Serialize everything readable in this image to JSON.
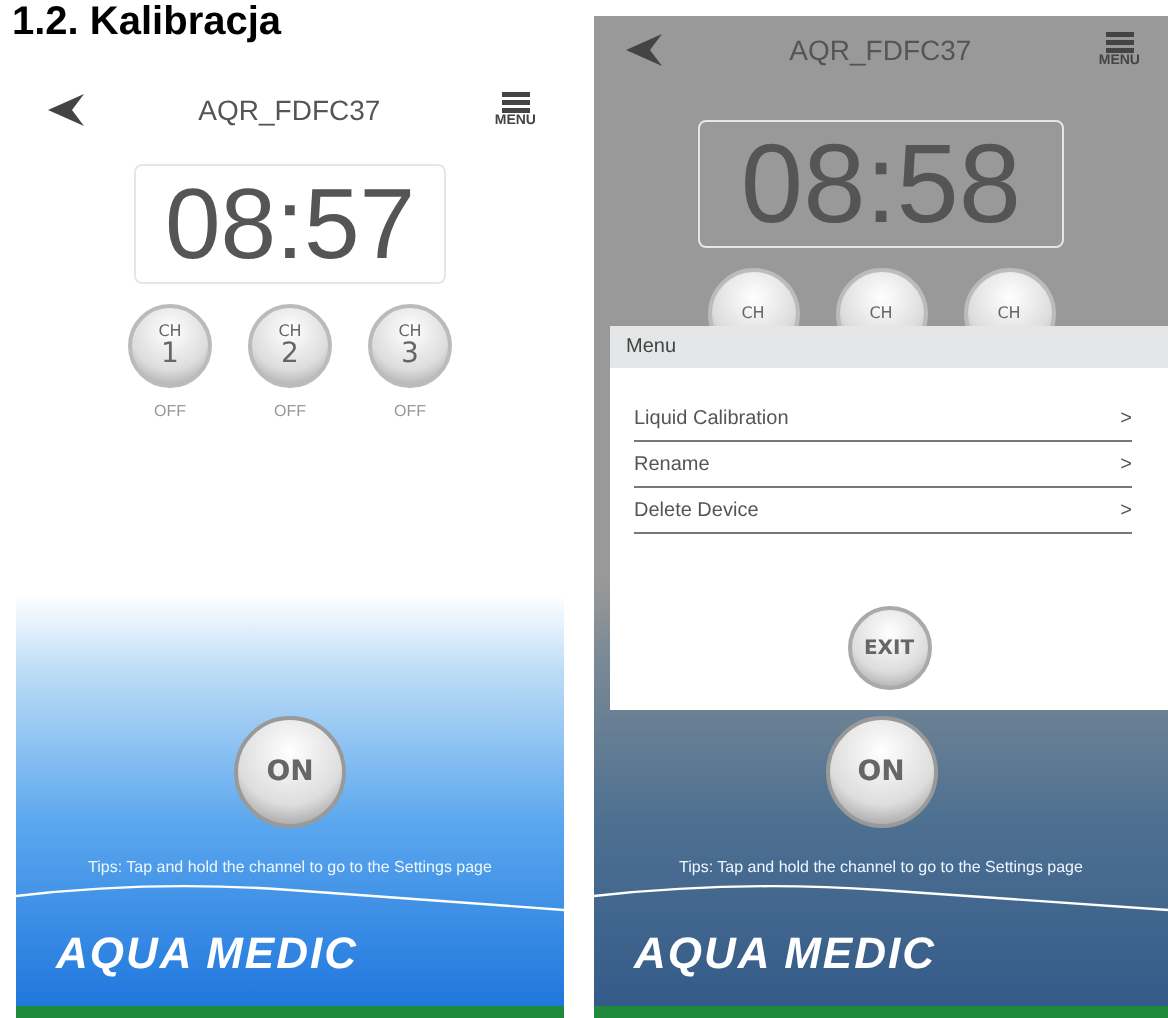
{
  "heading": "1.2. Kalibracja",
  "screens": [
    {
      "device_name": "AQR_FDFC37",
      "menu_label": "MENU",
      "time": "08:57",
      "channels": [
        {
          "label": "CH",
          "number": "1",
          "status": "OFF"
        },
        {
          "label": "CH",
          "number": "2",
          "status": "OFF"
        },
        {
          "label": "CH",
          "number": "3",
          "status": "OFF"
        }
      ],
      "power_button": "ON",
      "tip": "Tips: Tap and hold the channel to go to the Settings page",
      "brand": "AQUA MEDIC",
      "menu_open": false
    },
    {
      "device_name": "AQR_FDFC37",
      "menu_label": "MENU",
      "time": "08:58",
      "channels": [
        {
          "label": "CH"
        },
        {
          "label": "CH"
        },
        {
          "label": "CH"
        }
      ],
      "power_button": "ON",
      "tip": "Tips: Tap and hold the channel to go to the Settings page",
      "brand": "AQUA MEDIC",
      "menu_open": true,
      "menu": {
        "title": "Menu",
        "items": [
          {
            "label": "Liquid Calibration",
            "arrow": ">"
          },
          {
            "label": "Rename",
            "arrow": ">"
          },
          {
            "label": "Delete Device",
            "arrow": ">"
          }
        ],
        "exit_button": "EXIT"
      }
    }
  ]
}
